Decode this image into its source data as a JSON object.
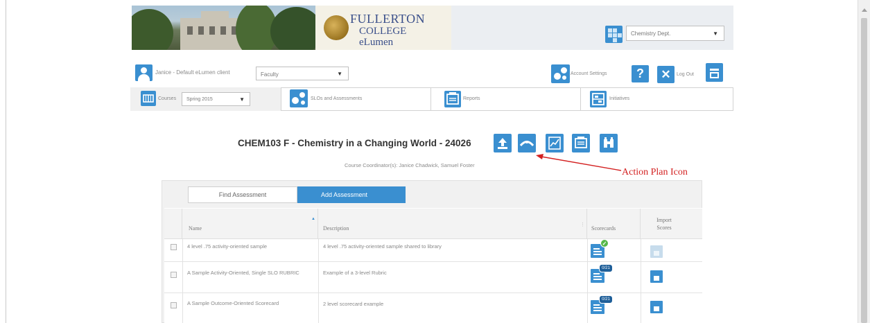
{
  "header": {
    "logo_line1": "FULLERTON",
    "logo_line2": "COLLEGE",
    "logo_sub": "eLumen",
    "logo_tagline": "",
    "department_select": "Chemistry Dept."
  },
  "userbar": {
    "user_label": "Janice - Default eLumen client",
    "role_select": "Faculty",
    "account_settings_label": "Account Settings",
    "logout_label": "Log Out"
  },
  "nav": {
    "tabs": [
      {
        "label": "Courses",
        "icon": "courses-icon"
      },
      {
        "label": "SLOs and Assessments",
        "icon": "slo-icon"
      },
      {
        "label": "Reports",
        "icon": "reports-icon"
      },
      {
        "label": "Initiatives",
        "icon": "initiatives-icon"
      }
    ],
    "term_select": "Spring 2015"
  },
  "course": {
    "title": "CHEM103 F - Chemistry in a Changing World - 24026",
    "coordinators": "Course Coordinator(s): Janice Chadwick, Samuel Foster",
    "action_icons": [
      "upload-icon",
      "action-plan-icon",
      "chart-icon",
      "document-icon",
      "binoculars-icon"
    ]
  },
  "annotation": {
    "label": "Action Plan Icon",
    "color": "#d32020"
  },
  "assessments": {
    "find_label": "Find Assessment",
    "add_label": "Add Assessment",
    "columns": [
      "Name",
      "Description",
      "Scorecards",
      "Import Scores"
    ],
    "rows": [
      {
        "name": "4 level .75 activity-oriented sample",
        "description": "4 level .75 activity-oriented sample shared to library",
        "scorecard_badge": "check",
        "import_enabled": false
      },
      {
        "name": "A Sample Activity-Oriented, Single SLO RUBRIC",
        "description": "Example of a 3-level Rubric",
        "scorecard_badge": "0/21",
        "import_enabled": true
      },
      {
        "name": "A Sample Outcome-Oriented Scorecard",
        "description": "2 level scorecard example",
        "scorecard_badge": "0/21",
        "import_enabled": true
      }
    ]
  },
  "colors": {
    "accent": "#3a8fd0",
    "panel_bg": "#f1f1f1"
  }
}
